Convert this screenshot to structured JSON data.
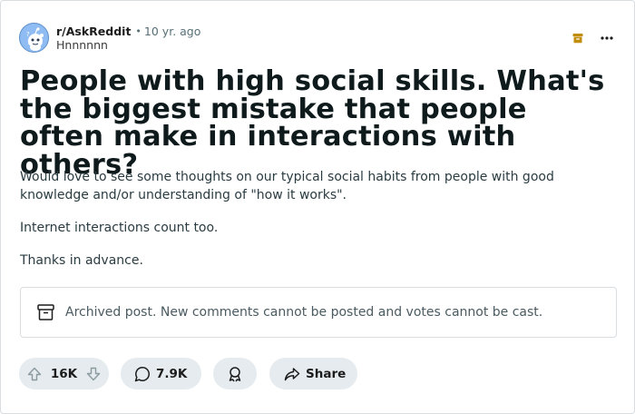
{
  "post": {
    "subreddit": "r/AskReddit",
    "separator": "•",
    "time_ago": "10 yr. ago",
    "username": "Hnnnnnn",
    "title": "People with high social skills. What's the biggest mistake that people often make in interactions with others?",
    "body": [
      "Would love to see some thoughts on our typical social habits from people with good knowledge and/or understanding of \"how it works\".",
      "Internet interactions count too.",
      "Thanks in advance."
    ]
  },
  "notice": {
    "text": "Archived post. New comments cannot be posted and votes cannot be cast."
  },
  "actions": {
    "vote_count": "16K",
    "comment_count": "7.9K",
    "share_label": "Share"
  },
  "colors": {
    "archive_badge": "#c18d0b",
    "pill_background": "#e5ebee",
    "avatar_background": "#8fbcf2"
  },
  "icons": {
    "avatar": "reddit-snoo-avatar",
    "archive_badge": "archive-box-icon",
    "more": "ellipsis-icon",
    "notice": "archive-box-icon",
    "upvote": "arrow-up-icon",
    "downvote": "arrow-down-icon",
    "comment": "speech-bubble-icon",
    "award": "award-ribbon-icon",
    "share": "share-arrow-icon"
  }
}
